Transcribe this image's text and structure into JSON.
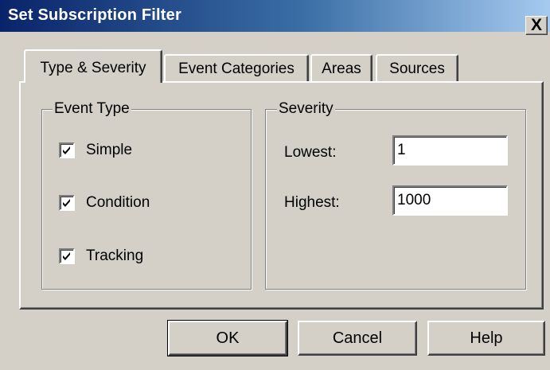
{
  "window": {
    "title": "Set Subscription Filter",
    "close_label": "X"
  },
  "tabs": [
    {
      "label": "Type & Severity",
      "active": true
    },
    {
      "label": "Event Categories",
      "active": false
    },
    {
      "label": "Areas",
      "active": false
    },
    {
      "label": "Sources",
      "active": false
    }
  ],
  "event_type": {
    "group_label": "Event Type",
    "options": [
      {
        "label": "Simple",
        "checked": true
      },
      {
        "label": "Condition",
        "checked": true
      },
      {
        "label": "Tracking",
        "checked": true
      }
    ]
  },
  "severity": {
    "group_label": "Severity",
    "lowest_label": "Lowest:",
    "lowest_value": "1",
    "highest_label": "Highest:",
    "highest_value": "1000"
  },
  "buttons": {
    "ok": "OK",
    "cancel": "Cancel",
    "help": "Help"
  }
}
